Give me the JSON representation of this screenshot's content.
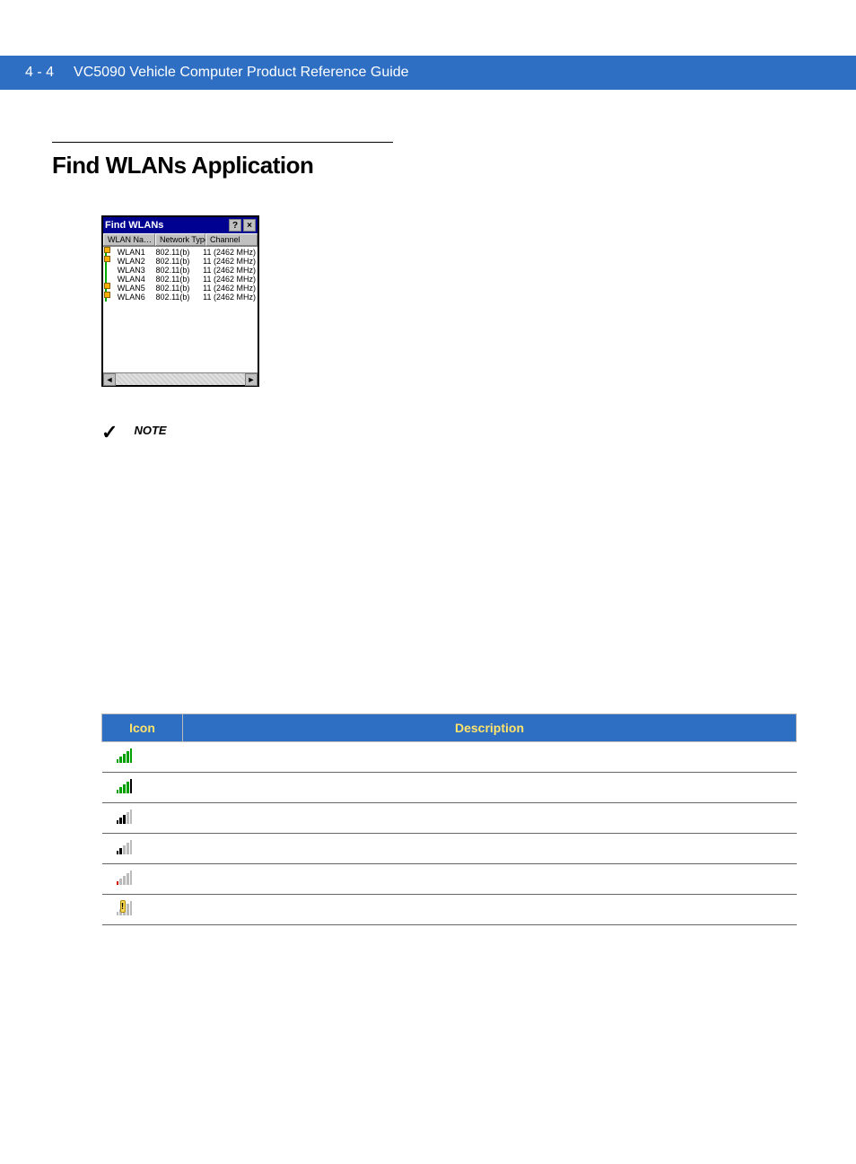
{
  "header": {
    "page_num": "4 - 4",
    "title": "VC5090 Vehicle Computer Product Reference Guide"
  },
  "section": {
    "title": "Find WLANs Application"
  },
  "window": {
    "title": "Find WLANs",
    "help_btn": "?",
    "close_btn": "×",
    "columns": {
      "c1": "WLAN Na…",
      "c2": "Network Type",
      "c3": "Channel"
    },
    "rows": [
      {
        "name": "WLAN1",
        "type": "802.11(b)",
        "channel": "11 (2462 MHz)",
        "locked": true
      },
      {
        "name": "WLAN2",
        "type": "802.11(b)",
        "channel": "11 (2462 MHz)",
        "locked": true
      },
      {
        "name": "WLAN3",
        "type": "802.11(b)",
        "channel": "11 (2462 MHz)",
        "locked": false
      },
      {
        "name": "WLAN4",
        "type": "802.11(b)",
        "channel": "11 (2462 MHz)",
        "locked": false
      },
      {
        "name": "WLAN5",
        "type": "802.11(b)",
        "channel": "11 (2462 MHz)",
        "locked": true
      },
      {
        "name": "WLAN6",
        "type": "802.11(b)",
        "channel": "11 (2462 MHz)",
        "locked": true
      }
    ],
    "scroll_left": "◄",
    "scroll_right": "►"
  },
  "note": {
    "check": "✓",
    "label": "NOTE"
  },
  "table": {
    "headers": {
      "icon": "Icon",
      "desc": "Description"
    },
    "rows": [
      {
        "desc": ""
      },
      {
        "desc": ""
      },
      {
        "desc": ""
      },
      {
        "desc": ""
      },
      {
        "desc": ""
      },
      {
        "desc": ""
      }
    ]
  }
}
